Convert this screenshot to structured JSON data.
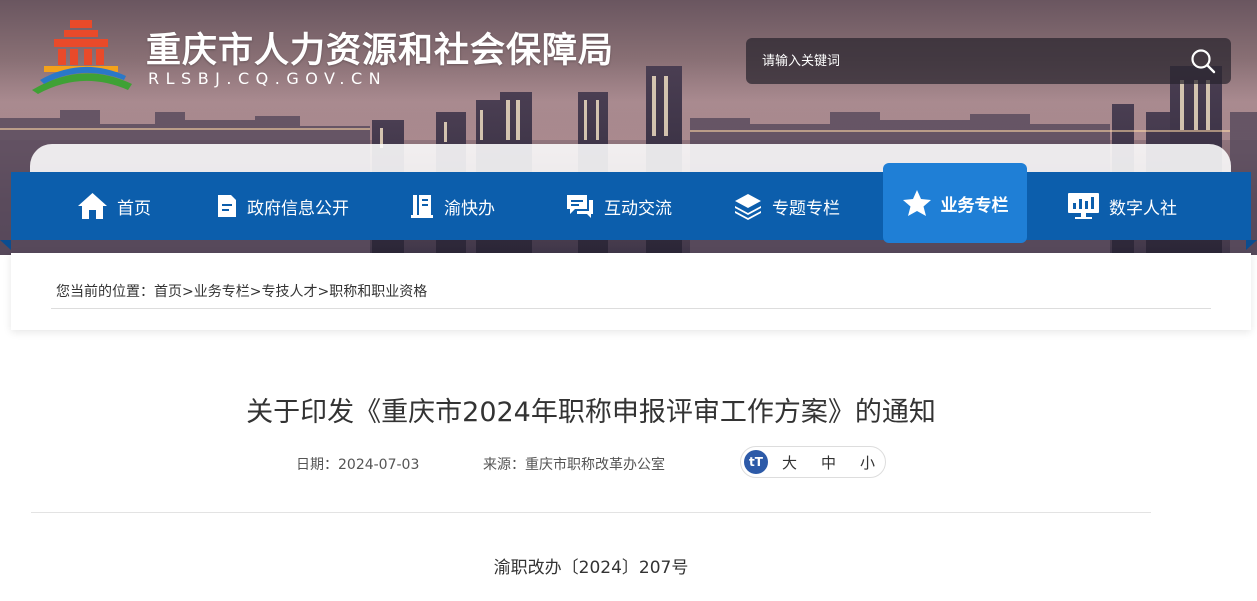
{
  "site": {
    "title": "重庆市人力资源和社会保障局",
    "domain": "RLSBJ.CQ.GOV.CN"
  },
  "search": {
    "placeholder": "请输入关键词",
    "button_icon": "search-icon"
  },
  "nav": {
    "items": [
      {
        "label": "首页",
        "icon": "home-icon"
      },
      {
        "label": "政府信息公开",
        "icon": "document-icon"
      },
      {
        "label": "渝快办",
        "icon": "book-icon"
      },
      {
        "label": "互动交流",
        "icon": "chat-icon"
      },
      {
        "label": "专题专栏",
        "icon": "layers-icon"
      },
      {
        "label": "业务专栏",
        "icon": "star-icon",
        "active": true
      },
      {
        "label": "数字人社",
        "icon": "monitor-chart-icon"
      }
    ]
  },
  "breadcrumb": {
    "prefix": "您当前的位置：",
    "items": [
      "首页",
      "业务专栏",
      "专技人才",
      "职称和职业资格"
    ],
    "separator": ">"
  },
  "article": {
    "title": "关于印发《重庆市2024年职称申报评审工作方案》的通知",
    "date_label": "日期：",
    "date": "2024-07-03",
    "source_label": "来源：",
    "source": "重庆市职称改革办公室",
    "font_sizes": [
      "大",
      "中",
      "小"
    ],
    "doc_number": "渝职改办〔2024〕207号"
  },
  "colors": {
    "nav_bg": "#0c5eac",
    "nav_active": "#1f7fd6",
    "text": "#333333"
  }
}
